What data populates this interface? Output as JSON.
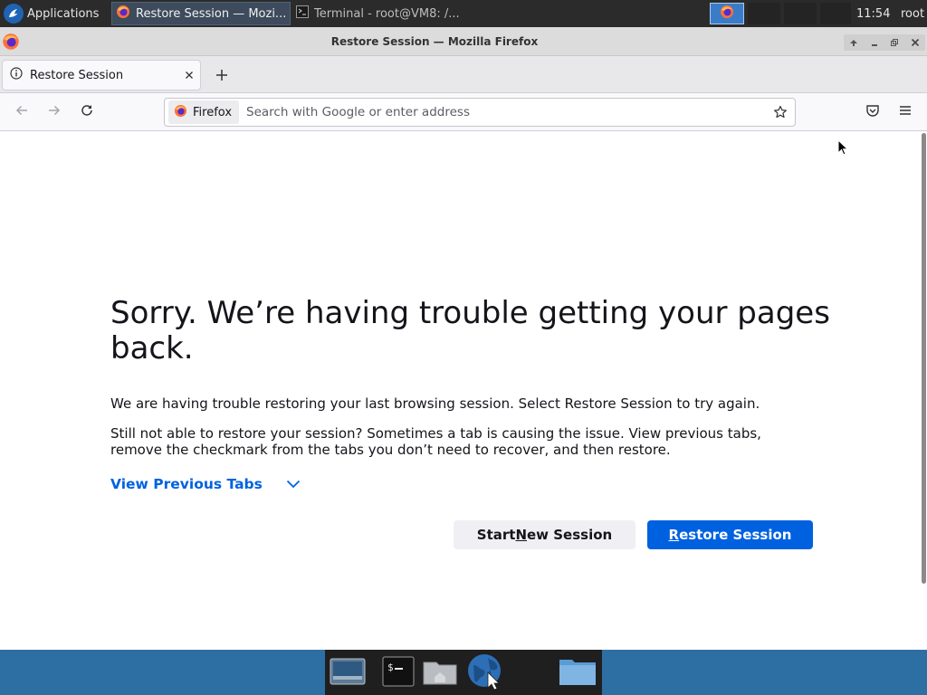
{
  "top_panel": {
    "applications_label": "Applications",
    "tasks": [
      {
        "label": "Restore Session — Mozi..."
      },
      {
        "label": "Terminal - root@VM8: /..."
      }
    ],
    "clock": "11:54",
    "user": "root"
  },
  "window": {
    "title": "Restore Session — Mozilla Firefox"
  },
  "tabs": [
    {
      "label": "Restore Session"
    }
  ],
  "navbar": {
    "identity_label": "Firefox",
    "url_placeholder": "Search with Google or enter address"
  },
  "page": {
    "title": "Sorry. We’re having trouble getting your pages back.",
    "description_1": "We are having trouble restoring your last browsing session. Select Restore Session to try again.",
    "description_2": "Still not able to restore your session? Sometimes a tab is causing the issue. View previous tabs, remove the checkmark from the tabs you don’t need to recover, and then restore.",
    "view_previous_tabs": "View Previous Tabs",
    "start_new_session": {
      "before": "Start ",
      "accesskey": "N",
      "after": "ew Session"
    },
    "restore_session": {
      "before": "",
      "accesskey": "R",
      "after": "estore Session"
    }
  },
  "colors": {
    "accent": "#0061e0",
    "panel": "#2b2b2b",
    "desktop": "#2e6fa3"
  },
  "icons": [
    "applications-icon",
    "firefox-icon",
    "terminal-icon",
    "info-icon",
    "close-icon",
    "plus-icon",
    "back-arrow-icon",
    "forward-arrow-icon",
    "reload-icon",
    "star-icon",
    "pocket-icon",
    "hamburger-menu-icon",
    "chevron-down-icon",
    "folder-icon",
    "globe-icon",
    "home-icon"
  ]
}
